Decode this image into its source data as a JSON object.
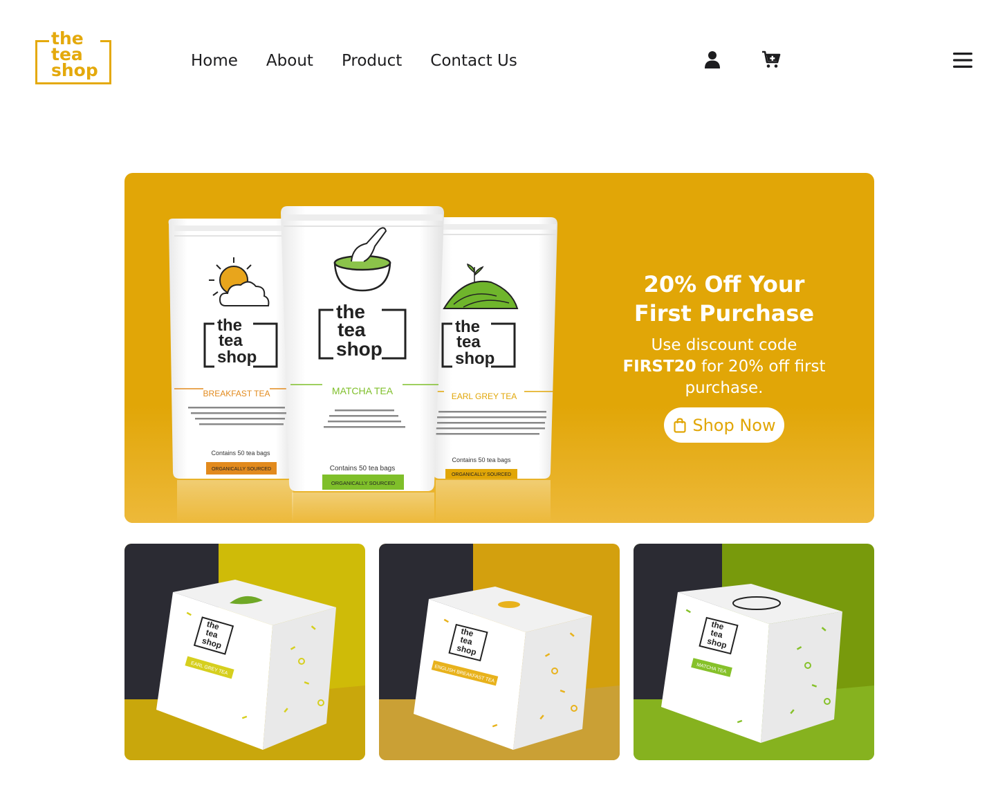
{
  "brand": {
    "logo_lines": [
      "the",
      "tea",
      "shop"
    ]
  },
  "nav": {
    "items": [
      {
        "label": "Home"
      },
      {
        "label": "About"
      },
      {
        "label": "Product"
      },
      {
        "label": "Contact Us"
      }
    ]
  },
  "header_icons": [
    "user-icon",
    "cart-plus-icon",
    "hamburger-menu-icon"
  ],
  "hero": {
    "title_line1": "20% Off Your",
    "title_line2": "First Purchase",
    "sub_prefix": "Use discount code",
    "code": "FIRST20",
    "sub_suffix": "for 20% off first purchase.",
    "cta_label": "Shop Now",
    "cta_icon": "shopping-bag-icon",
    "pouches": [
      {
        "brand": [
          "the",
          "tea",
          "shop"
        ],
        "name": "BREAKFAST TEA",
        "count": "Contains 50 tea bags",
        "badge": "ORGANICALLY SOURCED",
        "accent": "#e28a1d"
      },
      {
        "brand": [
          "the",
          "tea",
          "shop"
        ],
        "name": "MATCHA TEA",
        "count": "Contains 50 tea bags",
        "badge": "ORGANICALLY SOURCED",
        "accent": "#7fbf2a"
      },
      {
        "brand": [
          "the",
          "tea",
          "shop"
        ],
        "name": "EARL GREY TEA",
        "count": "Contains 50 tea bags",
        "badge": "ORGANICALLY SOURCED",
        "accent": "#e1a607"
      }
    ]
  },
  "products": [
    {
      "box_brand": [
        "the",
        "tea",
        "shop"
      ],
      "box_label": "EARL GREY TEA",
      "bg_color": "#cfbb08",
      "accent": "#d6cf1e"
    },
    {
      "box_brand": [
        "the",
        "tea",
        "shop"
      ],
      "box_label": "ENGLISH BREAKFAST TEA",
      "bg_color": "#d3a00e",
      "accent": "#e8b21c"
    },
    {
      "box_brand": [
        "the",
        "tea",
        "shop"
      ],
      "box_label": "MATCHA TEA",
      "bg_color": "#789a0c",
      "accent": "#86c12a"
    }
  ],
  "colors": {
    "brand_yellow": "#e4a90c",
    "hero_bg": "#e1a607",
    "text_dark": "#1d1d1f"
  }
}
